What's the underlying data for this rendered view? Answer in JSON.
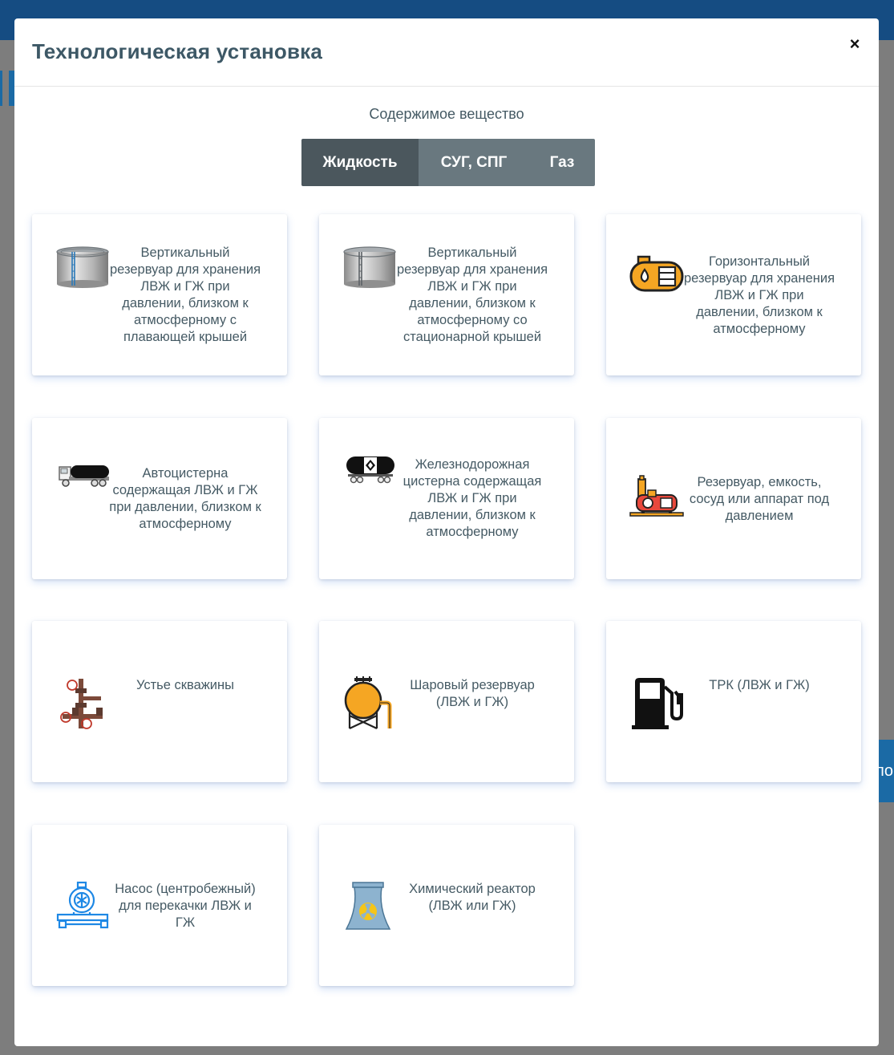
{
  "background": {
    "side_button_fragment": "по"
  },
  "modal": {
    "title": "Технологическая установка",
    "close_label": "×"
  },
  "substance": {
    "label": "Содержимое вещество",
    "options": [
      "Жидкость",
      "СУГ, СПГ",
      "Газ"
    ],
    "selected": "Жидкость"
  },
  "cards": [
    {
      "icon": "vertical-tank-floating-roof-icon",
      "label": "Вертикальный резервуар для хранения ЛВЖ и ГЖ при давлении, близком к атмосферному с плавающей крышей"
    },
    {
      "icon": "vertical-tank-fixed-roof-icon",
      "label": "Вертикальный резервуар для хранения ЛВЖ и ГЖ при давлении, близком к атмосферному со стационарной крышей"
    },
    {
      "icon": "horizontal-tank-icon",
      "label": "Горизонтальный резервуар для хранения ЛВЖ и ГЖ при давлении, близком к атмосферному"
    },
    {
      "icon": "tank-truck-icon",
      "label": "Автоцистерна содержащая ЛВЖ и ГЖ при давлении, близком к атмосферному"
    },
    {
      "icon": "rail-tank-car-icon",
      "label": "Железнодорожная цистерна содержащая ЛВЖ и ГЖ при давлении, близком к атмосферному"
    },
    {
      "icon": "pressure-vessel-icon",
      "label": "Резервуар, емкость, сосуд или аппарат под давлением"
    },
    {
      "icon": "wellhead-icon",
      "label": "Устье скважины"
    },
    {
      "icon": "spherical-tank-icon",
      "label": "Шаровый резервуар (ЛВЖ и ГЖ)"
    },
    {
      "icon": "fuel-dispenser-icon",
      "label": "ТРК (ЛВЖ и ГЖ)"
    },
    {
      "icon": "centrifugal-pump-icon",
      "label": "Насос (центробежный) для перекачки ЛВЖ и ГЖ"
    },
    {
      "icon": "chemical-reactor-icon",
      "label": "Химический реактор (ЛВЖ или ГЖ)"
    }
  ],
  "colors": {
    "header_bar": "#154c82",
    "segment_active": "#4b575d",
    "segment_inactive": "#69787f",
    "text": "#455a64"
  }
}
